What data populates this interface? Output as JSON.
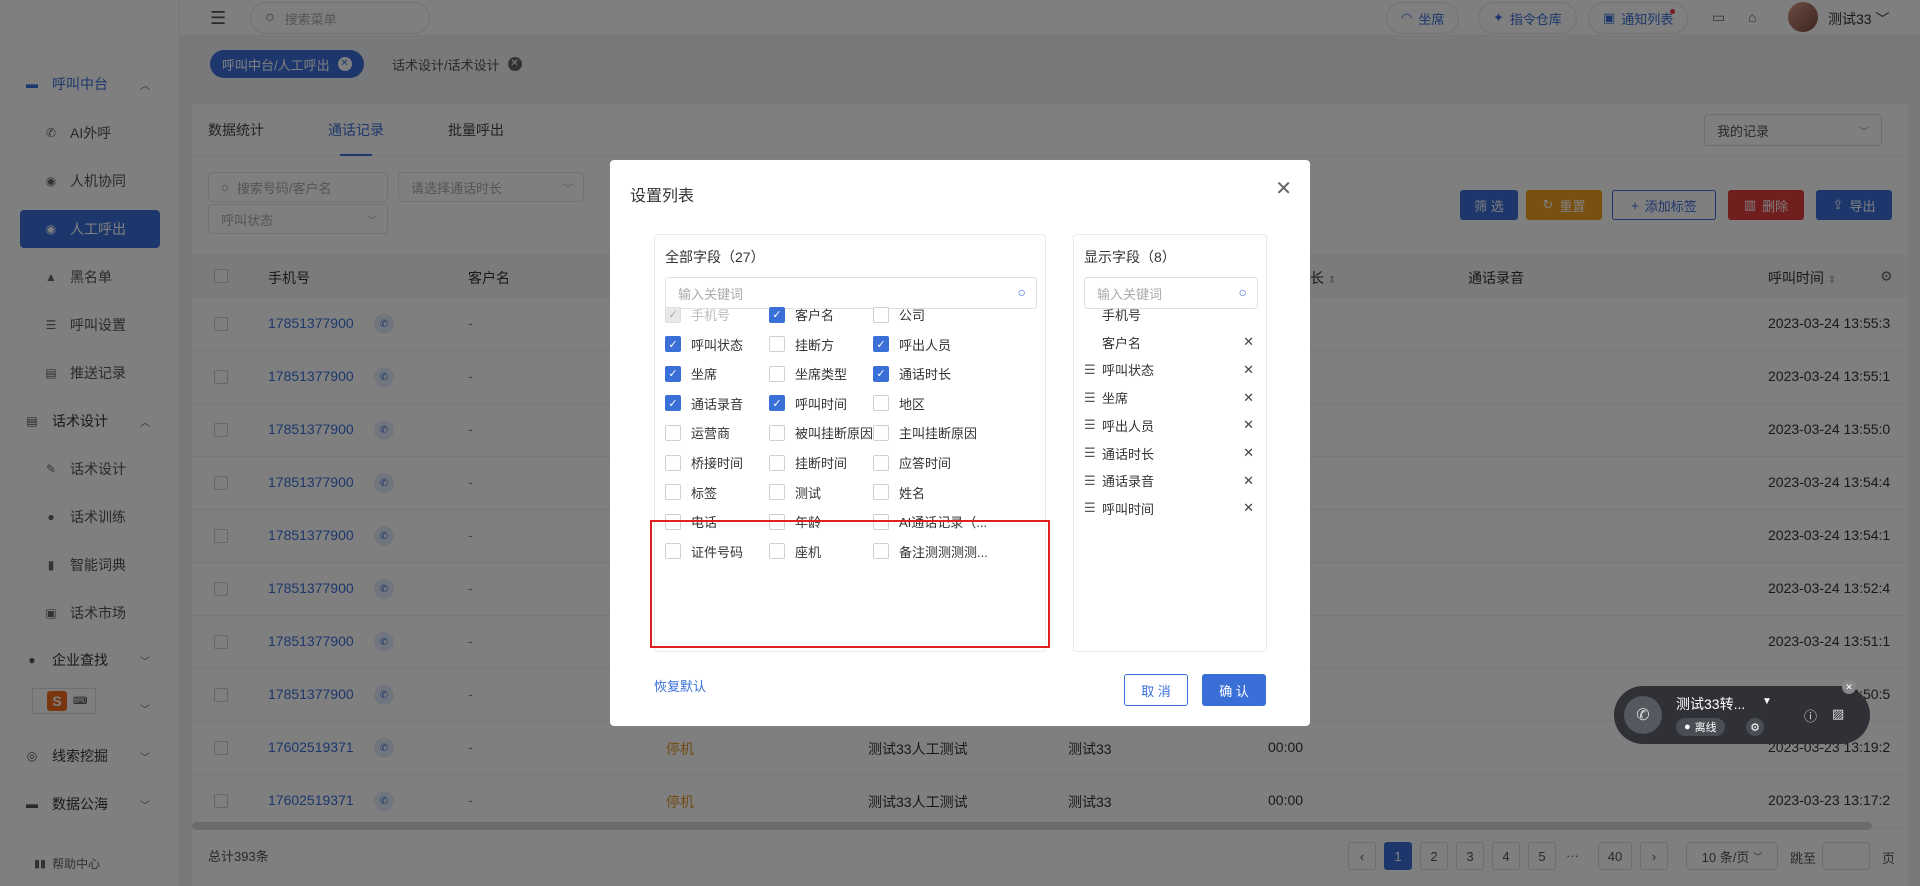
{
  "sidebar": {
    "groups": [
      {
        "label": "呼叫中台",
        "icon": "monitor-icon"
      },
      {
        "label": "话术设计",
        "icon": "document-icon"
      },
      {
        "label": "企业查找",
        "icon": "bulb-icon"
      },
      {
        "label": "线索挖掘",
        "icon": "target-icon"
      },
      {
        "label": "数据公海",
        "icon": "chart-icon"
      }
    ],
    "items": [
      {
        "label": "AI外呼"
      },
      {
        "label": "人机协同"
      },
      {
        "label": "人工呼出"
      },
      {
        "label": "黑名单"
      },
      {
        "label": "呼叫设置"
      },
      {
        "label": "推送记录"
      },
      {
        "label": "话术设计"
      },
      {
        "label": "话术训练"
      },
      {
        "label": "智能词典"
      },
      {
        "label": "话术市场"
      }
    ],
    "help": "帮助中心"
  },
  "header": {
    "search_placeholder": "搜索菜单",
    "pill_seat": "坐席",
    "pill_command": "指令仓库",
    "pill_notice": "通知列表",
    "username": "测试33"
  },
  "tags": {
    "active": "呼叫中台/人工呼出",
    "other": "话术设计/话术设计"
  },
  "main": {
    "tabs": [
      "数据统计",
      "通话记录",
      "批量呼出"
    ],
    "my_records": "我的记录",
    "filters": {
      "search_placeholder": "搜索号码/客户名",
      "duration_placeholder": "请选择通话时长",
      "status_placeholder": "呼叫状态"
    },
    "buttons": {
      "filter": "筛 选",
      "reset": "重置",
      "add_tag": "添加标签",
      "delete": "删除",
      "export": "导出"
    },
    "columns": {
      "phone": "手机号",
      "customer": "客户名",
      "duration_partial": "长",
      "recording": "通话录音",
      "call_time": "呼叫时间"
    },
    "rows": [
      {
        "phone": "17851377900",
        "name": "-",
        "status": "",
        "agent": "",
        "caller": "",
        "dur": "",
        "time": "2023-03-24 13:55:3"
      },
      {
        "phone": "17851377900",
        "name": "-",
        "status": "",
        "agent": "",
        "caller": "",
        "dur": "",
        "time": "2023-03-24 13:55:1"
      },
      {
        "phone": "17851377900",
        "name": "-",
        "status": "",
        "agent": "",
        "caller": "",
        "dur": "",
        "time": "2023-03-24 13:55:0"
      },
      {
        "phone": "17851377900",
        "name": "-",
        "status": "",
        "agent": "",
        "caller": "",
        "dur": "",
        "time": "2023-03-24 13:54:4"
      },
      {
        "phone": "17851377900",
        "name": "-",
        "status": "",
        "agent": "",
        "caller": "",
        "dur": "",
        "time": "2023-03-24 13:54:1"
      },
      {
        "phone": "17851377900",
        "name": "-",
        "status": "",
        "agent": "",
        "caller": "",
        "dur": "",
        "time": "2023-03-24 13:52:4"
      },
      {
        "phone": "17851377900",
        "name": "-",
        "status": "",
        "agent": "",
        "caller": "",
        "dur": "",
        "time": "2023-03-24 13:51:1"
      },
      {
        "phone": "17851377900",
        "name": "-",
        "status": "",
        "agent": "",
        "caller": "",
        "dur": "",
        "time": "2023-03-24 13:50:5"
      },
      {
        "phone": "17602519371",
        "name": "-",
        "status": "停机",
        "agent": "测试33人工测试",
        "caller": "测试33",
        "dur": "00:00",
        "time": "2023-03-23 13:19:2"
      },
      {
        "phone": "17602519371",
        "name": "-",
        "status": "停机",
        "agent": "测试33人工测试",
        "caller": "测试33",
        "dur": "00:00",
        "time": "2023-03-23 13:17:2"
      }
    ],
    "total": "总计393条",
    "pages": [
      "1",
      "2",
      "3",
      "4",
      "5",
      "···",
      "40"
    ],
    "page_size": "10 条/页",
    "goto": "跳至",
    "page_unit": "页"
  },
  "call_widget": {
    "name": "测试33转...",
    "status": "离线"
  },
  "modal": {
    "title": "设置列表",
    "all_fields_title": "全部字段（27）",
    "show_fields_title": "显示字段（8）",
    "keyword_placeholder": "输入关键词",
    "options": [
      {
        "label": "手机号",
        "checked": true,
        "disabled": true
      },
      {
        "label": "客户名",
        "checked": true
      },
      {
        "label": "公司",
        "checked": false
      },
      {
        "label": "呼叫状态",
        "checked": true
      },
      {
        "label": "挂断方",
        "checked": false
      },
      {
        "label": "呼出人员",
        "checked": true
      },
      {
        "label": "坐席",
        "checked": true
      },
      {
        "label": "坐席类型",
        "checked": false
      },
      {
        "label": "通话时长",
        "checked": true
      },
      {
        "label": "通话录音",
        "checked": true
      },
      {
        "label": "呼叫时间",
        "checked": true
      },
      {
        "label": "地区",
        "checked": false
      },
      {
        "label": "运营商",
        "checked": false
      },
      {
        "label": "被叫挂断原因",
        "checked": false
      },
      {
        "label": "主叫挂断原因",
        "checked": false
      },
      {
        "label": "桥接时间",
        "checked": false
      },
      {
        "label": "挂断时间",
        "checked": false
      },
      {
        "label": "应答时间",
        "checked": false
      },
      {
        "label": "标签",
        "checked": false
      },
      {
        "label": "测试",
        "checked": false
      },
      {
        "label": "姓名",
        "checked": false
      },
      {
        "label": "电话",
        "checked": false
      },
      {
        "label": "年龄",
        "checked": false
      },
      {
        "label": "AI通话记录（...",
        "checked": false
      },
      {
        "label": "证件号码",
        "checked": false
      },
      {
        "label": "座机",
        "checked": false
      },
      {
        "label": "备注测测测测...",
        "checked": false
      }
    ],
    "shown": [
      {
        "label": "手机号",
        "fixed": true
      },
      {
        "label": "客户名",
        "fixed": true
      },
      {
        "label": "呼叫状态"
      },
      {
        "label": "坐席"
      },
      {
        "label": "呼出人员"
      },
      {
        "label": "通话时长"
      },
      {
        "label": "通话录音"
      },
      {
        "label": "呼叫时间"
      }
    ],
    "restore": "恢复默认",
    "cancel": "取 消",
    "confirm": "确 认"
  },
  "colors": {
    "primary": "#3a6fd8",
    "filter_btn": "#3a6fd8",
    "reset_btn": "#f0a020",
    "delete_btn": "#e03c3c",
    "highlight_box": "#e02020",
    "status_warn": "#e59b2a"
  }
}
